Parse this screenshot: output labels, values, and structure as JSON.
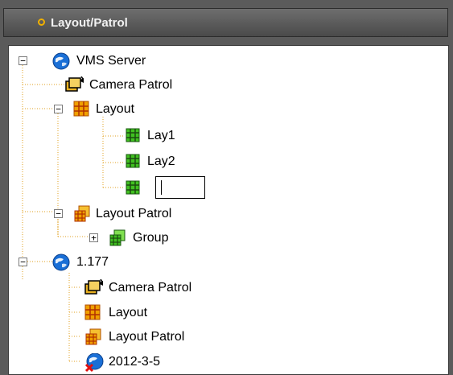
{
  "panel": {
    "title": "Layout/Patrol"
  },
  "tree": {
    "nodes": [
      {
        "label": "VMS Server",
        "icon": "server-globe-icon",
        "expanded": true
      },
      {
        "label": "Camera Patrol",
        "icon": "camera-patrol-icon"
      },
      {
        "label": "Layout",
        "icon": "layout-grid-icon",
        "expanded": true
      },
      {
        "label": "Lay1",
        "icon": "layout-green-icon"
      },
      {
        "label": "Lay2",
        "icon": "layout-green-icon"
      },
      {
        "label": "",
        "icon": "layout-green-icon",
        "editing": true
      },
      {
        "label": "Layout Patrol",
        "icon": "layout-patrol-icon",
        "expanded": true
      },
      {
        "label": "Group",
        "icon": "layout-patrol-group-icon",
        "expanded": false
      },
      {
        "label": "1.177",
        "icon": "server-globe-icon",
        "expanded": true
      },
      {
        "label": "Camera Patrol",
        "icon": "camera-patrol-icon"
      },
      {
        "label": "Layout",
        "icon": "layout-grid-icon"
      },
      {
        "label": "Layout Patrol",
        "icon": "layout-patrol-icon"
      },
      {
        "label": "2012-3-5",
        "icon": "server-disconnected-icon"
      }
    ],
    "expander_symbols": {
      "expanded": "−",
      "collapsed": "+"
    }
  },
  "colors": {
    "header_bg": "#5b5b5b",
    "accent": "#f0b000",
    "tree_line": "#e0a020"
  }
}
